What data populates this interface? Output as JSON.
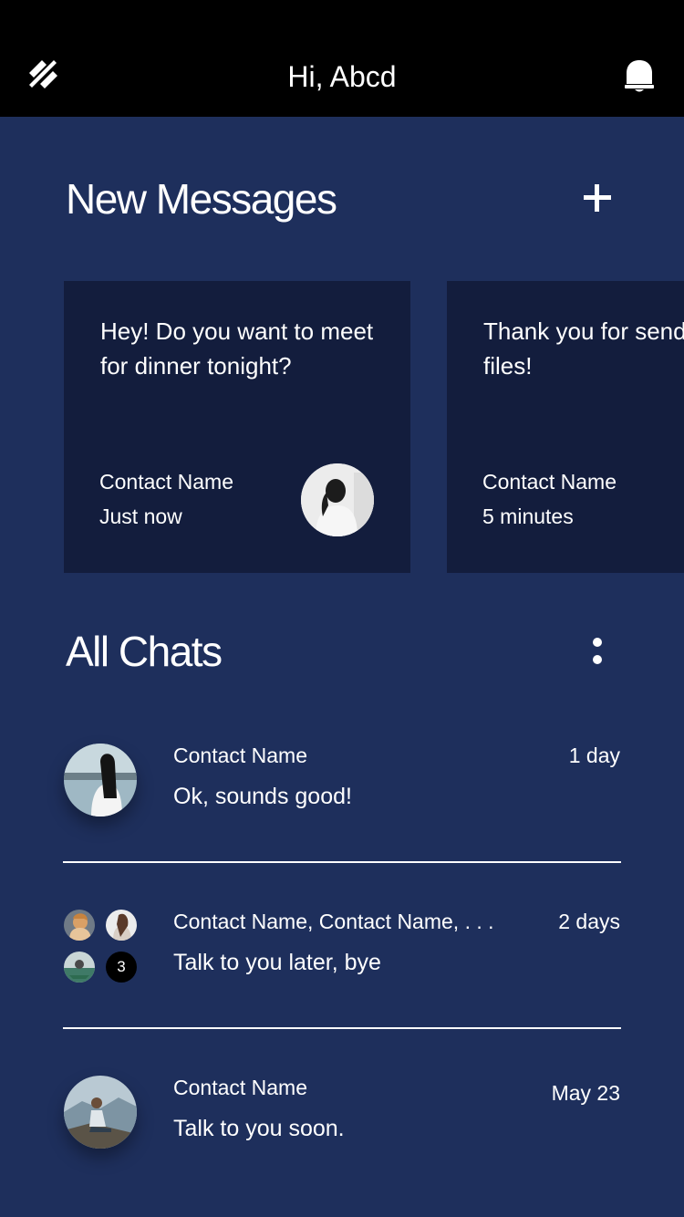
{
  "header": {
    "greeting": "Hi, Abcd"
  },
  "new_messages": {
    "title": "New Messages",
    "cards": [
      {
        "text": "Hey! Do you want to meet for dinner tonight?",
        "contact": "Contact Name",
        "time": "Just now"
      },
      {
        "text": "Thank you for sending over the files!",
        "contact": "Contact Name",
        "time": "5 minutes"
      }
    ]
  },
  "all_chats": {
    "title": "All Chats",
    "chats": [
      {
        "contact": "Contact Name",
        "time": "1 day",
        "message": "Ok, sounds good!"
      },
      {
        "contact": "Contact Name, Contact Name, . . .",
        "time": "2 days",
        "message": "Talk to you later, bye",
        "extra_count": "3"
      },
      {
        "contact": "Contact Name",
        "time": "May 23",
        "message": "Talk to you soon."
      }
    ]
  },
  "colors": {
    "background": "#1e2f5c",
    "card": "#131d3d",
    "header": "#000000"
  },
  "icons": [
    "menu-icon",
    "bell-icon",
    "plus-icon",
    "more-vertical-icon"
  ]
}
